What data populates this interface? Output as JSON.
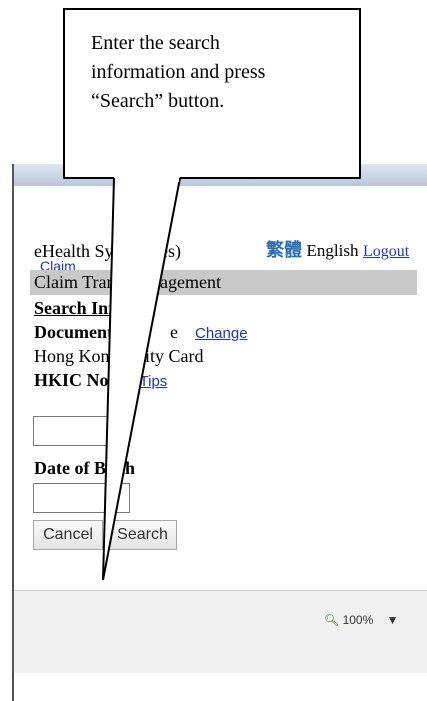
{
  "callout": {
    "line1": "Enter the search",
    "line2": "information and press",
    "line3": "“Search” button."
  },
  "header": {
    "system_title": "eHealth Sys          bsidies)",
    "chinese_label": "繁體",
    "english_label": "English",
    "logout_label": "Logout",
    "claim_link": "Claim"
  },
  "section": {
    "title": "Claim Trans          Management",
    "search_info": "Search Inf          tion"
  },
  "form": {
    "document_label": "Document",
    "document_suffix": "e",
    "change_label": "Change",
    "document_value": "Hong Kong          entity Card",
    "hkic_label": "HKIC No",
    "tips_label": "Tips",
    "dob_label": "Date of Birth",
    "cancel_label": "Cancel",
    "search_label": "Search"
  },
  "status": {
    "zoom": "100%"
  }
}
